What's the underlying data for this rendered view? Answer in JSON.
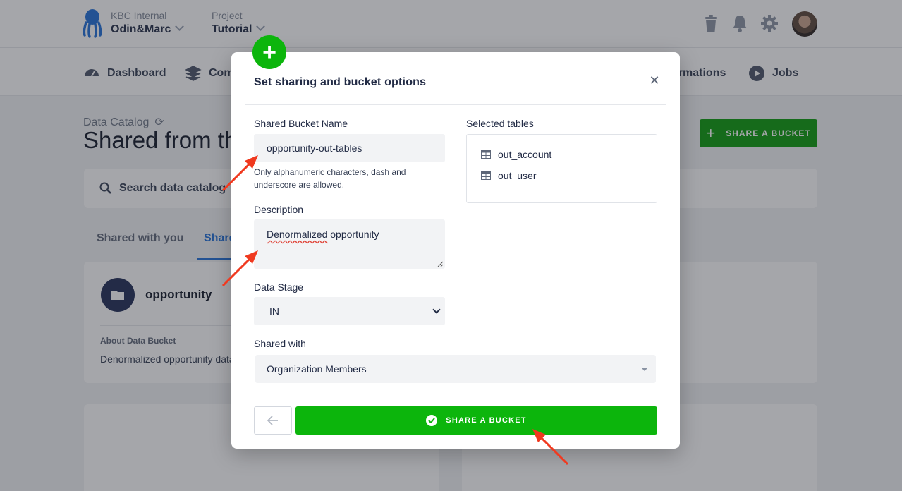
{
  "header": {
    "org_label": "KBC Internal",
    "org_name": "Odin&Marc",
    "project_label": "Project",
    "project_name": "Tutorial"
  },
  "nav": {
    "items": [
      {
        "label": "Dashboard",
        "icon": "dashboard-icon"
      },
      {
        "label": "Components",
        "icon": "layers-icon"
      },
      {
        "label": "Transformations",
        "icon": "transformations-icon"
      },
      {
        "label": "Jobs",
        "icon": "play-icon"
      }
    ]
  },
  "page": {
    "subtitle": "Data Catalog",
    "title": "Shared from this project",
    "share_button": "SHARE A BUCKET",
    "search_placeholder": "Search data catalog",
    "tabs": [
      "Shared with you",
      "Shared from this project"
    ]
  },
  "card": {
    "title": "opportunity",
    "about_label": "About Data Bucket",
    "about_text": "Denormalized opportunity data"
  },
  "modal": {
    "title": "Set sharing and bucket options",
    "bucket_name_label": "Shared Bucket Name",
    "bucket_name_value": "opportunity-out-tables",
    "bucket_name_help": "Only alphanumeric characters, dash and underscore are allowed.",
    "description_label": "Description",
    "description_value_word1": "Denormalized",
    "description_value_rest": " opportunity",
    "stage_label": "Data Stage",
    "stage_value": "IN",
    "shared_with_label": "Shared with",
    "shared_with_value": "Organization Members",
    "selected_tables_label": "Selected tables",
    "tables": [
      "out_account",
      "out_user"
    ],
    "submit_label": "SHARE A BUCKET"
  },
  "colors": {
    "primary_green": "#0cb50c",
    "accent_blue": "#1f6fd8",
    "annotation_red": "#f0391f"
  }
}
